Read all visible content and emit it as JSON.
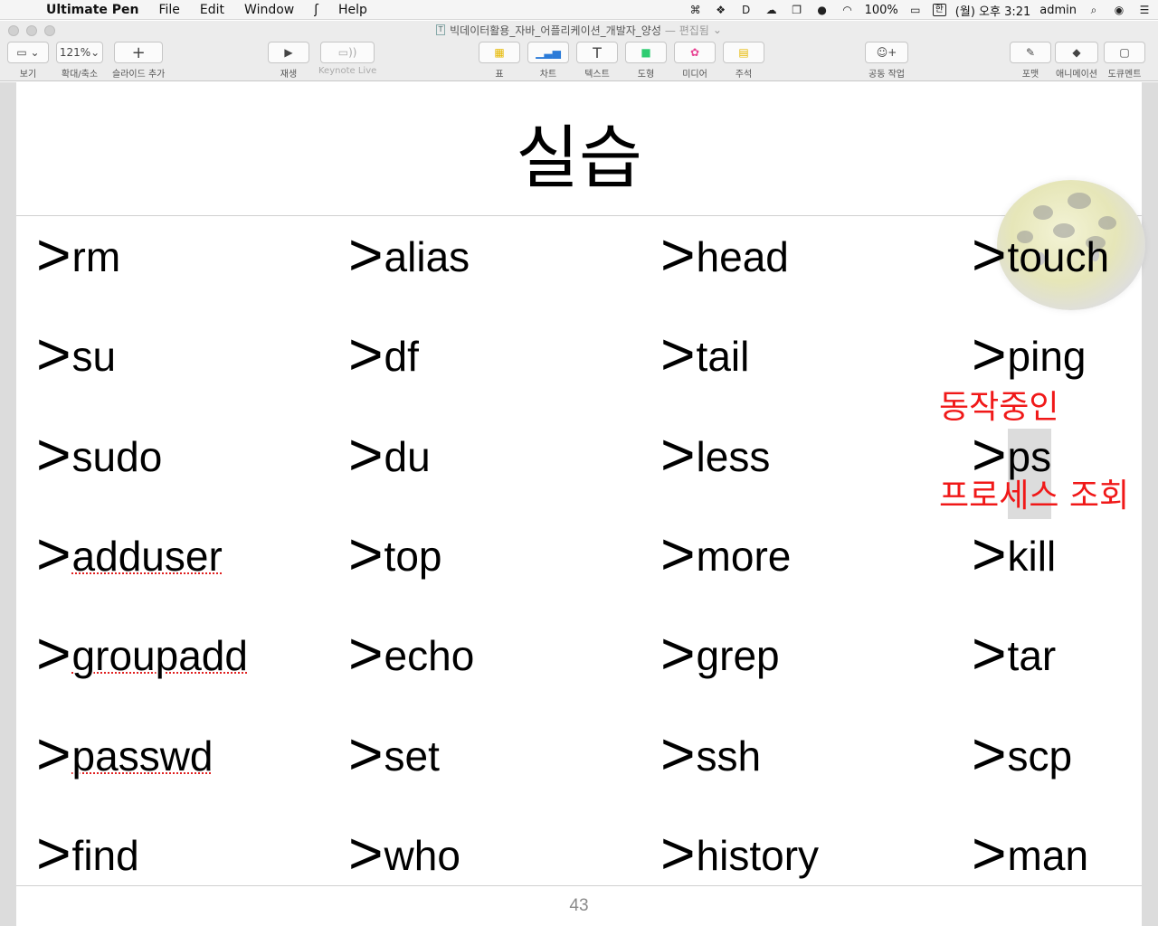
{
  "menubar": {
    "app_name": "Ultimate Pen",
    "menus": [
      "File",
      "Edit",
      "Window",
      "Help"
    ],
    "battery": "100%",
    "input_source": "한",
    "clock": "(월) 오후 3:21",
    "user": "admin"
  },
  "window": {
    "title": "빅데이터활용_자바_어플리케이션_개발자_양성",
    "status": "— 편집됨"
  },
  "toolbar": {
    "view_label": "보기",
    "zoom_value": "121%",
    "zoom_label": "확대/축소",
    "add_slide_label": "슬라이드 추가",
    "play_label": "재생",
    "keynote_live_label": "Keynote Live",
    "table_label": "표",
    "chart_label": "차트",
    "text_label": "텍스트",
    "shape_label": "도형",
    "media_label": "미디어",
    "comment_label": "주석",
    "collaborate_label": "공동 작업",
    "format_label": "포맷",
    "animate_label": "애니메이션",
    "document_label": "도큐멘트"
  },
  "slide": {
    "title": "실습",
    "number": "43",
    "prompt": ">",
    "commands": [
      [
        "rm",
        "alias",
        "head",
        "touch"
      ],
      [
        "su",
        "df",
        "tail",
        "ping"
      ],
      [
        "sudo",
        "du",
        "less",
        "ps"
      ],
      [
        "adduser",
        "top",
        "more",
        "kill"
      ],
      [
        "groupadd",
        "echo",
        "grep",
        "tar"
      ],
      [
        "passwd",
        "set",
        "ssh",
        "scp"
      ],
      [
        "find",
        "who",
        "history",
        "man"
      ]
    ],
    "annotation_above": "동작중인",
    "annotation_below": "프로세스 조회"
  },
  "colors": {
    "annotation": "#f01818",
    "highlight": "#dcdcdc"
  }
}
